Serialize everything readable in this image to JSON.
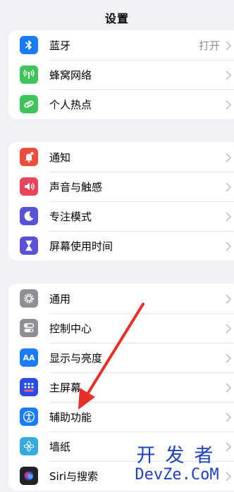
{
  "header": {
    "title": "设置"
  },
  "group1": [
    {
      "name": "bluetooth",
      "label": "蓝牙",
      "value": "打开",
      "color": "#1a7cf5",
      "icon": "bluetooth-icon"
    },
    {
      "name": "cellular",
      "label": "蜂窝网络",
      "color": "#3fc45b",
      "icon": "antenna-icon"
    },
    {
      "name": "hotspot",
      "label": "个人热点",
      "color": "#3fc45b",
      "icon": "hotspot-link-icon"
    }
  ],
  "group2": [
    {
      "name": "notifications",
      "label": "通知",
      "color": "#eb4d3d",
      "icon": "bell-icon"
    },
    {
      "name": "sounds",
      "label": "声音与触感",
      "color": "#eb445a",
      "icon": "speaker-icon"
    },
    {
      "name": "focus",
      "label": "专注模式",
      "color": "#5a52d6",
      "icon": "moon-icon"
    },
    {
      "name": "screen-time",
      "label": "屏幕使用时间",
      "color": "#5a52d6",
      "icon": "hourglass-icon"
    }
  ],
  "group3": [
    {
      "name": "general",
      "label": "通用",
      "color": "#8e8e93",
      "icon": "gear-icon"
    },
    {
      "name": "control-center",
      "label": "控制中心",
      "color": "#8e8e93",
      "icon": "toggles-icon"
    },
    {
      "name": "display",
      "label": "显示与亮度",
      "color": "#1a7cf5",
      "icon": "text-size-icon",
      "glyph": "AA"
    },
    {
      "name": "home-screen",
      "label": "主屏幕",
      "color": "#2c4ee0",
      "icon": "app-grid-icon"
    },
    {
      "name": "accessibility",
      "label": "辅助功能",
      "color": "#1a7cf5",
      "icon": "accessibility-icon"
    },
    {
      "name": "wallpaper",
      "label": "墙纸",
      "color": "#35aadc",
      "icon": "flower-icon"
    },
    {
      "name": "siri",
      "label": "Siri与搜索",
      "color": "#222222",
      "icon": "siri-icon"
    }
  ],
  "watermark": {
    "cn": "开发者",
    "en": "DevZe.CoM"
  },
  "colors": {
    "annotation_arrow": "#e5302a",
    "watermark": "#1f3fbf"
  }
}
